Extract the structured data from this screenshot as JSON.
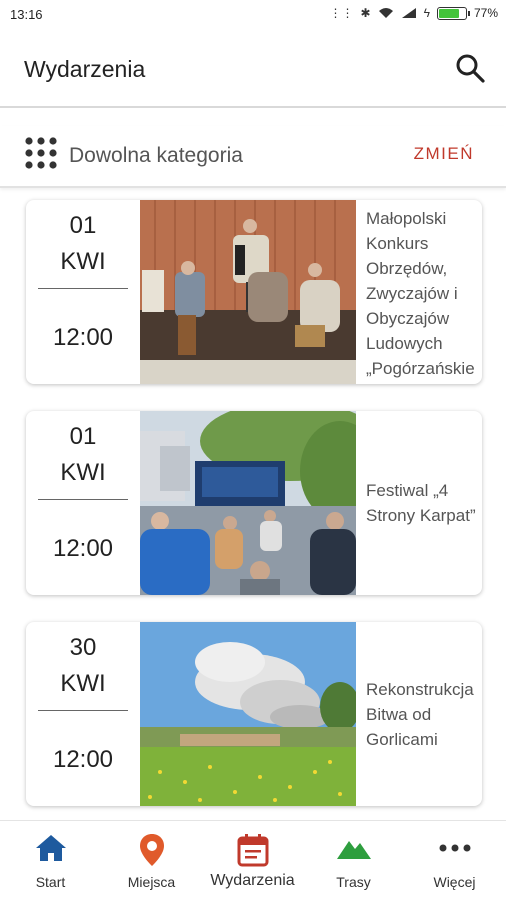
{
  "status_bar": {
    "time": "13:16",
    "battery": "77%",
    "battery_fraction": 0.77
  },
  "header": {
    "title": "Wydarzenia",
    "search_icon": "search-icon"
  },
  "filter": {
    "label": "Dowolna kategoria",
    "change_label": "ZMIEŃ",
    "accent": "#c0392b"
  },
  "events": [
    {
      "day": "01",
      "month": "KWI",
      "time": "12:00",
      "name": "Małopolski Konkurs Obrzędów, Zwyczajów i Obyczajów Ludowych „Pogórzańskie Gody”"
    },
    {
      "day": "01",
      "month": "KWI",
      "time": "12:00",
      "name": "Festiwal „4 Strony Karpat”"
    },
    {
      "day": "30",
      "month": "KWI",
      "time": "12:00",
      "name": "Rekonstrukcja Bitwa od Gorlicami"
    }
  ],
  "nav": {
    "items": [
      {
        "label": "Start",
        "icon": "home-icon",
        "color": "#1e5a9e"
      },
      {
        "label": "Miejsca",
        "icon": "map-pin-icon",
        "color": "#e05a2b"
      },
      {
        "label": "Wydarzenia",
        "icon": "calendar-icon",
        "color": "#c0392b"
      },
      {
        "label": "Trasy",
        "icon": "mountain-icon",
        "color": "#2e9e3e"
      },
      {
        "label": "Więcej",
        "icon": "more-dots-icon",
        "color": "#333333"
      }
    ]
  }
}
